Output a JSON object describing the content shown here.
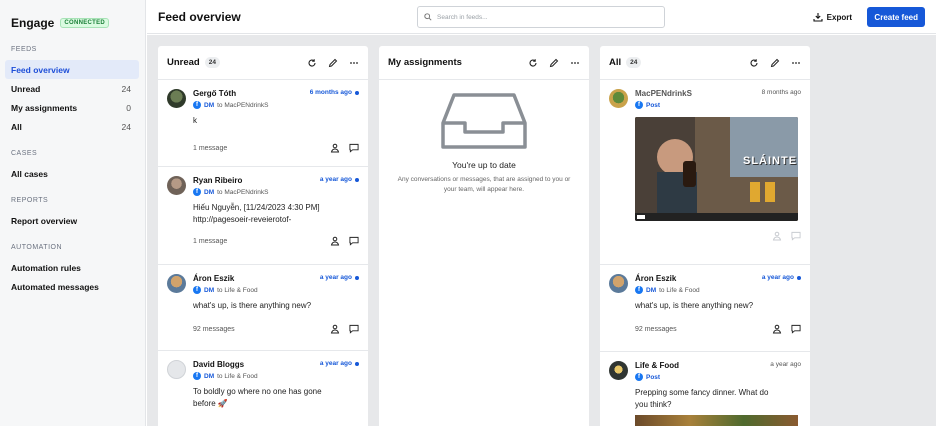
{
  "app": {
    "name": "Engage",
    "status": "CONNECTED"
  },
  "sidebar": {
    "sections": [
      {
        "title": "FEEDS",
        "items": [
          {
            "label": "Feed overview",
            "count": "",
            "active": true
          },
          {
            "label": "Unread",
            "count": "24"
          },
          {
            "label": "My assignments",
            "count": "0"
          },
          {
            "label": "All",
            "count": "24"
          }
        ]
      },
      {
        "title": "CASES",
        "items": [
          {
            "label": "All cases",
            "count": ""
          }
        ]
      },
      {
        "title": "REPORTS",
        "items": [
          {
            "label": "Report overview",
            "count": ""
          }
        ]
      },
      {
        "title": "AUTOMATION",
        "items": [
          {
            "label": "Automation rules",
            "count": ""
          },
          {
            "label": "Automated messages",
            "count": ""
          }
        ]
      }
    ]
  },
  "header": {
    "title": "Feed overview",
    "search_placeholder": "Search in feeds...",
    "export_label": "Export",
    "create_label": "Create feed"
  },
  "columns": {
    "unread": {
      "title": "Unread",
      "count": "24",
      "items": [
        {
          "name": "Gergő Tóth",
          "type": "DM",
          "to": "to MacPENdrinkS",
          "time": "6 months ago",
          "text": "k",
          "footer": "1 message"
        },
        {
          "name": "Ryan Ribeiro",
          "type": "DM",
          "to": "to MacPENdrinkS",
          "time": "a year ago",
          "text": "Hiếu Nguyễn, [11/24/2023 4:30 PM]",
          "text2": "http://pagesoeir-reveierotof-",
          "footer": "1 message"
        },
        {
          "name": "Áron Eszik",
          "type": "DM",
          "to": "to Life & Food",
          "time": "a year ago",
          "text": "what's up, is there anything new?",
          "footer": "92 messages"
        },
        {
          "name": "David Bloggs",
          "type": "DM",
          "to": "to Life & Food",
          "time": "a year ago",
          "text": "To boldly go where no one has gone",
          "text2": "before 🚀",
          "footer": ""
        }
      ]
    },
    "assignments": {
      "title": "My assignments",
      "empty_title": "You're up to date",
      "empty_text": "Any conversations or messages, that are assigned to you or your team, will appear here."
    },
    "all": {
      "title": "All",
      "count": "24",
      "items": [
        {
          "name": "MacPENdrinkS",
          "type": "Post",
          "time": "8 months ago",
          "image_caption": "SLÁINTE"
        },
        {
          "name": "Áron Eszik",
          "type": "DM",
          "to": "to Life & Food",
          "time": "a year ago",
          "text": "what's up, is there anything new?",
          "footer": "92 messages"
        },
        {
          "name": "Life & Food",
          "type": "Post",
          "time": "a year ago",
          "text": "Prepping some fancy dinner. What do",
          "text2": "you think?"
        }
      ]
    }
  },
  "colors": {
    "accent": "#1658d8",
    "facebook": "#1877f2",
    "connected": "#1a7f37"
  }
}
